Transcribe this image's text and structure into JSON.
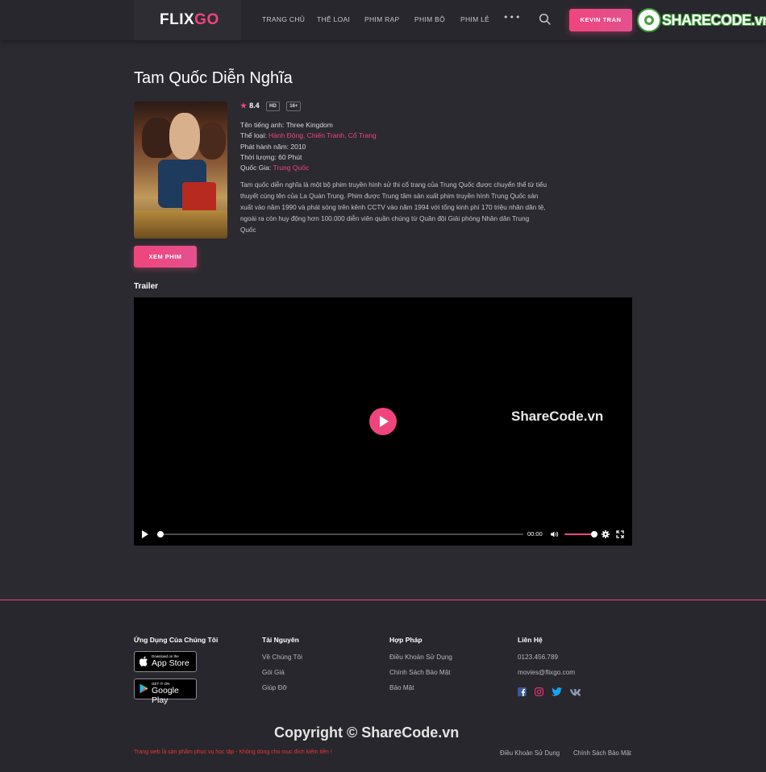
{
  "brand": {
    "logo_main": "FLIX",
    "logo_accent": "GO",
    "accent_color": "#f0457c"
  },
  "nav": {
    "items": [
      "TRANG CHỦ",
      "THỂ LOẠI",
      "PHIM RẠP",
      "PHIM BỘ",
      "PHIM LẺ"
    ],
    "more": "•••",
    "search_icon": "search-icon",
    "user_label": "KEVIN TRAN"
  },
  "watermark": {
    "header_text": "SHARECODE.vn",
    "player_text": "ShareCode.vn",
    "footer_text": "Copyright © ShareCode.vn"
  },
  "movie": {
    "title": "Tam Quốc Diễn Nghĩa",
    "rating": "8.4",
    "badges": [
      "HD",
      "16+"
    ],
    "english_label": "Tên tiếng anh:",
    "english_value": "Three Kingdom",
    "genre_label": "Thể loại:",
    "genre_value": "Hành Động, Chiến Tranh, Cổ Trang",
    "year_label": "Phát hành năm:",
    "year_value": "2010",
    "duration_label": "Thời lượng:",
    "duration_value": "60 Phút",
    "country_label": "Quốc Gia:",
    "country_value": "Trung Quốc",
    "description": "Tam quốc diễn nghĩa là một bộ phim truyền hình sử thi cổ trang của Trung Quốc được chuyển thể từ tiểu thuyết cùng tên của La Quán Trung. Phim được Trung tâm sản xuất phim truyền hình Trung Quốc sản xuất vào năm 1990 và phát sóng trên kênh CCTV vào năm 1994 với tổng kinh phí 170 triệu nhân dân tệ, ngoài ra còn huy động hơn 100.000 diễn viên quần chúng từ Quân đội Giải phóng Nhân dân Trung Quốc",
    "watch_label": "XEM PHIM"
  },
  "trailer": {
    "label": "Trailer",
    "time": "00:00",
    "progress": 0,
    "volume": 1.0
  },
  "footer": {
    "apps_heading": "Ứng Dụng Của Chúng Tôi",
    "app_store_small": "Download on the",
    "app_store_big": "App Store",
    "google_small": "GET IT ON",
    "google_big": "Google Play",
    "resources_heading": "Tài Nguyên",
    "resources": [
      "Về Chúng Tôi",
      "Gói Giá",
      "Giúp Đỡ"
    ],
    "legal_heading": "Hợp Pháp",
    "legal": [
      "Điều Khoản Sử Dụng",
      "Chính Sách Bảo Mật",
      "Bảo Mật"
    ],
    "contact_heading": "Liên Hệ",
    "phone": "0123.456.789",
    "email": "movies@flixgo.com",
    "notice": "Trang web là sản phẩm phục vụ học tập - Không dùng cho mục đích kiếm tiền !",
    "bottom_links": [
      "Điều Khoản Sử Dụng",
      "Chính Sách Bảo Mật"
    ]
  }
}
